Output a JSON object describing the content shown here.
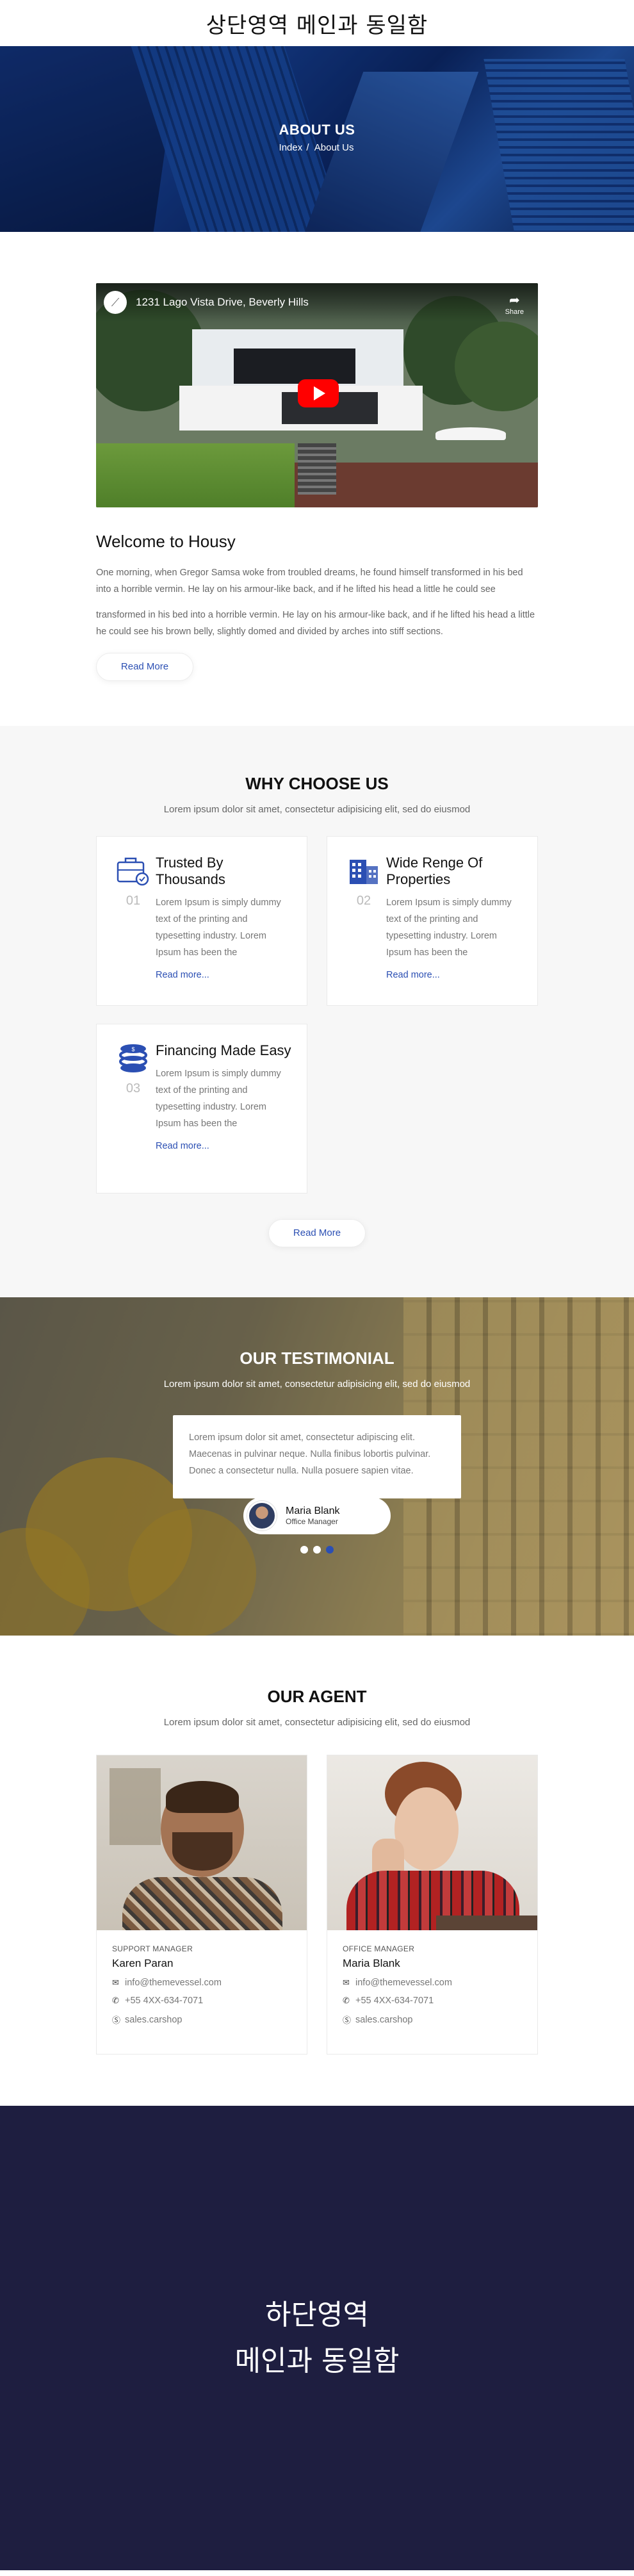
{
  "header": {
    "title": "상단영역 메인과 동일함"
  },
  "hero": {
    "title": "ABOUT US",
    "crumb_index": "Index",
    "crumb_sep": "/",
    "crumb_current": "About Us"
  },
  "about": {
    "video_title": "1231 Lago Vista Drive, Beverly Hills",
    "video_share": "Share",
    "heading": "Welcome to Housy",
    "para1": "One morning, when Gregor Samsa woke from troubled dreams, he found himself transformed in his bed into a horrible vermin. He lay on his armour-like back, and if he lifted his head a little he could see",
    "para2": "transformed in his bed into a horrible vermin. He lay on his armour-like back, and if he lifted his head a little he could see his brown belly, slightly domed and divided by arches into stiff sections.",
    "button": "Read More"
  },
  "why": {
    "title": "WHY CHOOSE US",
    "subtitle": "Lorem ipsum dolor sit amet, consectetur adipisicing elit, sed do eiusmod",
    "cards": [
      {
        "num": "01",
        "icon": "briefcase-icon",
        "title": "Trusted By Thousands",
        "desc": "Lorem Ipsum is simply dummy text of the printing and typesetting industry. Lorem Ipsum has been the",
        "more": "Read more..."
      },
      {
        "num": "02",
        "icon": "building-icon",
        "title": "Wide Renge Of Properties",
        "desc": "Lorem Ipsum is simply dummy text of the printing and typesetting industry. Lorem Ipsum has been the",
        "more": "Read more..."
      },
      {
        "num": "03",
        "icon": "coins-icon",
        "title": "Financing Made Easy",
        "desc": "Lorem Ipsum is simply dummy text of the printing and typesetting industry. Lorem Ipsum has been the",
        "more": "Read more..."
      }
    ],
    "button": "Read More"
  },
  "testimonial": {
    "title": "OUR TESTIMONIAL",
    "subtitle": "Lorem ipsum dolor sit amet, consectetur adipisicing elit, sed do eiusmod",
    "quote": "Lorem ipsum dolor sit amet, consectetur adipiscing elit. Maecenas in pulvinar neque. Nulla finibus lobortis pulvinar. Donec a consectetur nulla. Nulla posuere sapien vitae.",
    "author_name": "Maria Blank",
    "author_role": "Office Manager",
    "slides": 3,
    "active_slide": 3
  },
  "agents": {
    "title": "OUR AGENT",
    "subtitle": "Lorem ipsum dolor sit amet, consectetur adipisicing elit, sed do eiusmod",
    "list": [
      {
        "role": "SUPPORT MANAGER",
        "name": "Karen Paran",
        "email": "info@themevessel.com",
        "phone": "+55 4XX-634-7071",
        "skype": "sales.carshop"
      },
      {
        "role": "OFFICE MANAGER",
        "name": "Maria Blank",
        "email": "info@themevessel.com",
        "phone": "+55 4XX-634-7071",
        "skype": "sales.carshop"
      }
    ]
  },
  "footer": {
    "line1": "하단영역",
    "line2": "메인과 동일함"
  },
  "colors": {
    "accent": "#2b4fb3",
    "footer_bg": "#1e1e40",
    "play_red": "#ff0000"
  }
}
